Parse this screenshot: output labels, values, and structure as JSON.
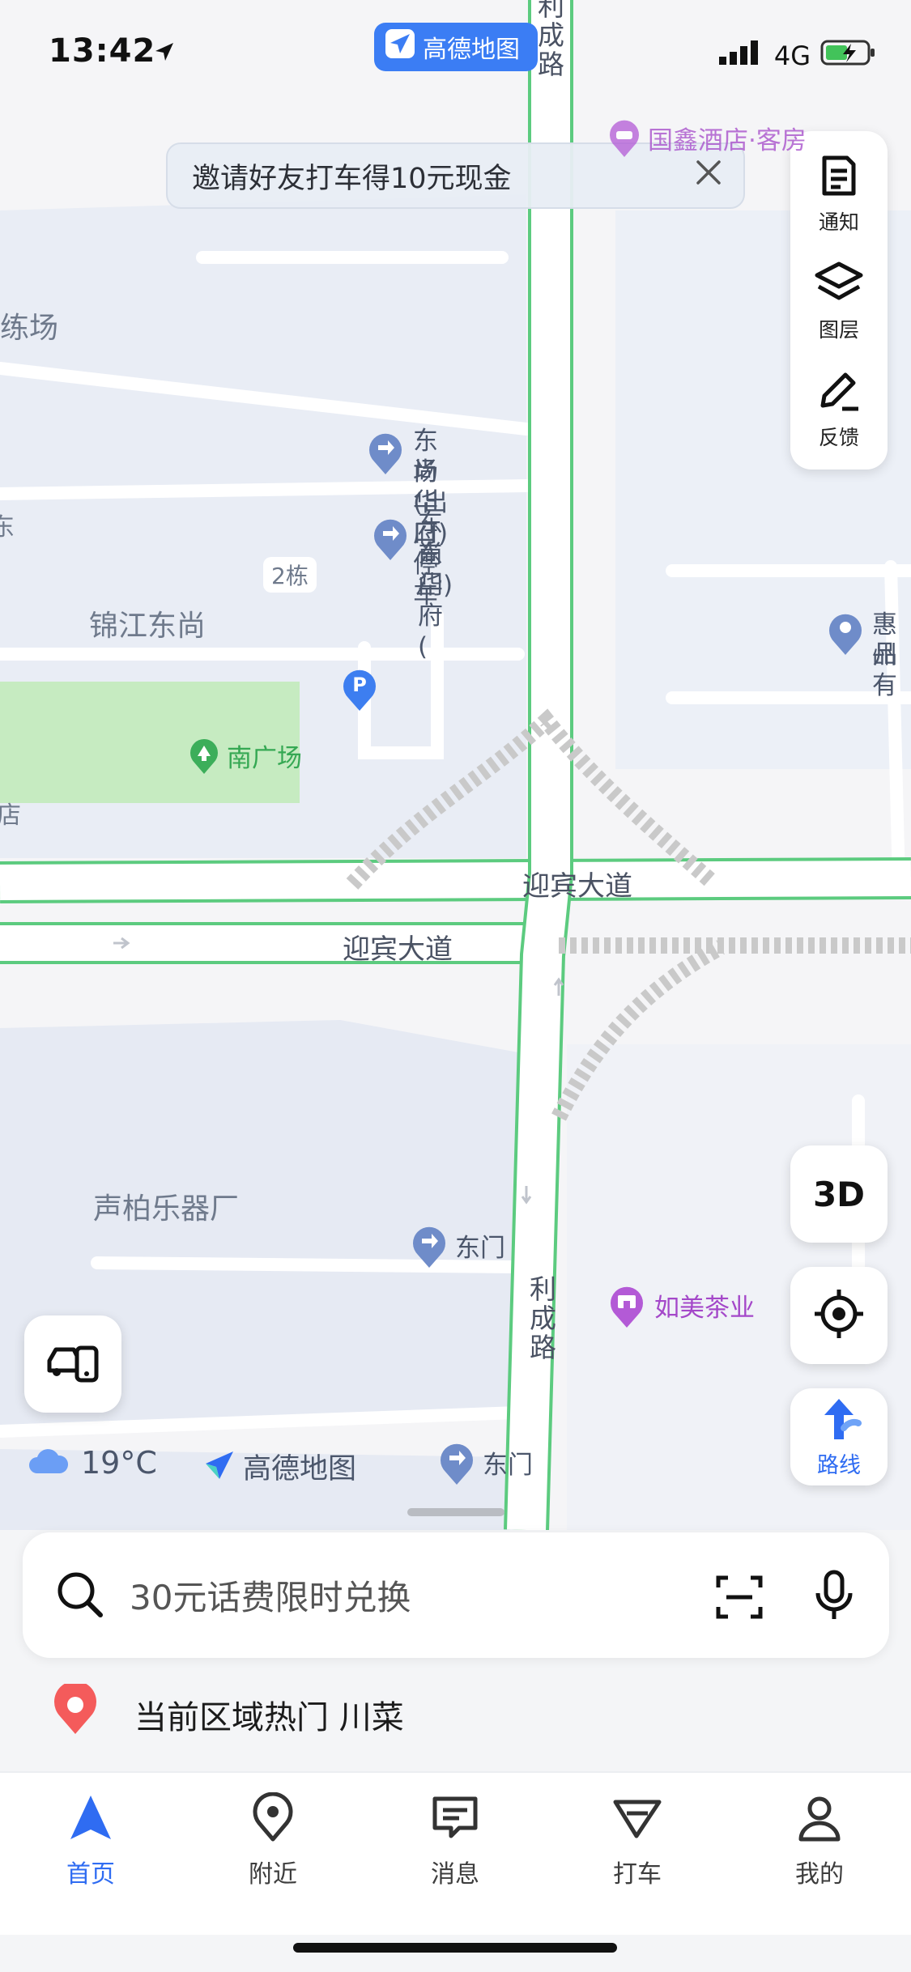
{
  "status": {
    "time": "13:42",
    "network": "4G"
  },
  "app_pill": {
    "label": "高德地图"
  },
  "invite_banner": {
    "text": "邀请好友打车得10元现金"
  },
  "tools": [
    {
      "label": "通知",
      "icon": "notice-icon"
    },
    {
      "label": "图层",
      "icon": "layers-icon"
    },
    {
      "label": "反馈",
      "icon": "feedback-icon"
    }
  ],
  "map": {
    "roads": {
      "licheng_top": "利成路",
      "licheng_bottom": "利成路",
      "yingbin_right": "迎宾大道",
      "yingbin_left": "迎宾大道"
    },
    "areas": {
      "training": "练场",
      "jinjiang": "锦江东尚",
      "shengbai": "声柏乐器厂",
      "building2": "2栋",
      "left_edge_1": "东",
      "left_edge_2": "店",
      "hui_top": "惠州",
      "hui_bottom": "品有"
    },
    "pois": {
      "hotel": "国鑫酒店·客房",
      "parking_exit_1": "东尚华府停车",
      "parking_exit_2": "场(出口)",
      "east_gate_1": "东尚华府(",
      "east_gate_2": "东门)",
      "south_square": "南广场",
      "dongmen_mid": "东门",
      "rumei_tea": "如美茶业",
      "dongmen_bottom": "东门"
    }
  },
  "buttons": {
    "three_d": "3D",
    "route": "路线"
  },
  "weather": {
    "temp": "19°C",
    "brand": "高德地图"
  },
  "search": {
    "placeholder": "30元话费限时兑换"
  },
  "hot": {
    "text": "当前区域热门 川菜"
  },
  "tabs": [
    {
      "label": "首页",
      "active": true
    },
    {
      "label": "附近",
      "active": false
    },
    {
      "label": "消息",
      "active": false
    },
    {
      "label": "打车",
      "active": false
    },
    {
      "label": "我的",
      "active": false
    }
  ],
  "colors": {
    "accent": "#2f6cf2",
    "road_edge": "#5ccb7f",
    "park": "#c6ebc1",
    "block": "#e7ebf5"
  }
}
